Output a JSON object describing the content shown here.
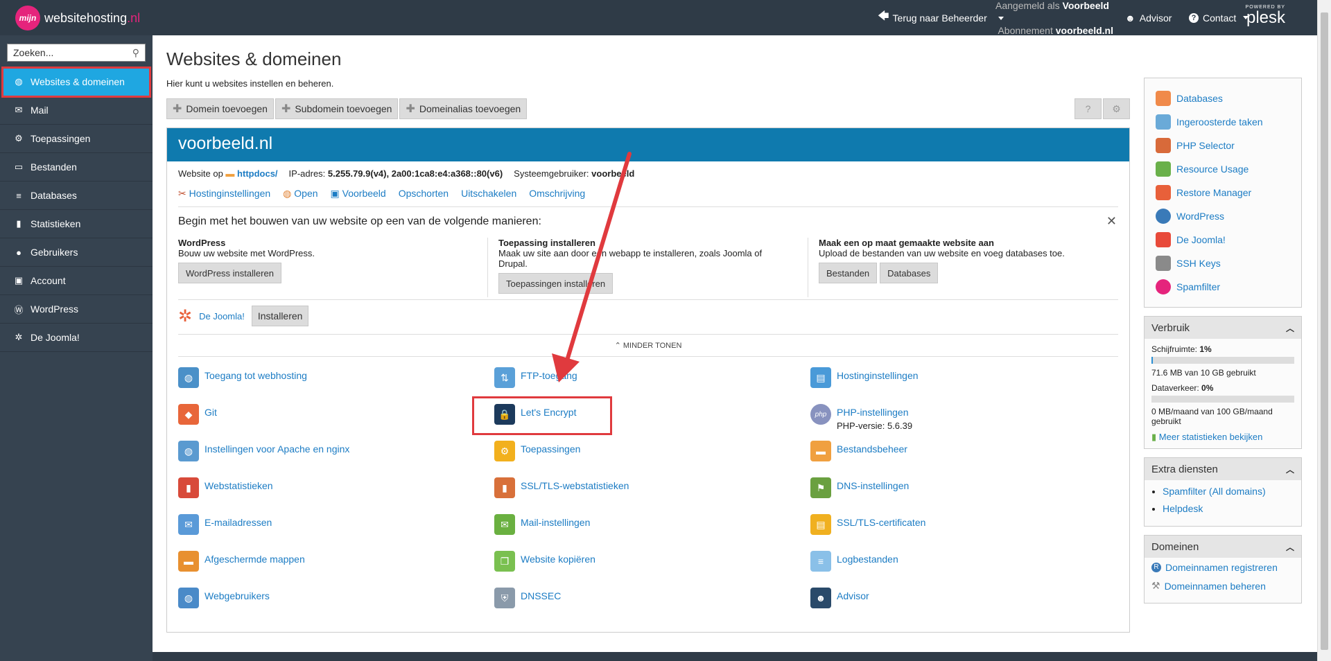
{
  "topbar": {
    "logo_prefix": "mijn",
    "logo_name": "websitehosting",
    "logo_tld": ".nl",
    "back_label": "Terug naar Beheerder",
    "logged_in_label": "Aangemeld als",
    "logged_in_user": "Voorbeeld",
    "subscription_label": "Abonnement",
    "subscription_value": "voorbeeld.nl",
    "advisor_label": "Advisor",
    "contact_label": "Contact",
    "powered_by": "POWERED BY",
    "plesk": "plesk"
  },
  "sidebar": {
    "search_placeholder": "Zoeken...",
    "items": [
      {
        "label": "Websites & domeinen",
        "icon": "globe-icon"
      },
      {
        "label": "Mail",
        "icon": "mail-icon"
      },
      {
        "label": "Toepassingen",
        "icon": "gear-icon"
      },
      {
        "label": "Bestanden",
        "icon": "folder-icon"
      },
      {
        "label": "Databases",
        "icon": "database-icon"
      },
      {
        "label": "Statistieken",
        "icon": "chart-icon"
      },
      {
        "label": "Gebruikers",
        "icon": "user-icon"
      },
      {
        "label": "Account",
        "icon": "account-icon"
      },
      {
        "label": "WordPress",
        "icon": "wordpress-icon"
      },
      {
        "label": "De Joomla!",
        "icon": "joomla-icon"
      }
    ]
  },
  "main": {
    "title": "Websites & domeinen",
    "subtitle": "Hier kunt u websites instellen en beheren.",
    "toolbar": [
      "Domein toevoegen",
      "Subdomein toevoegen",
      "Domeinalias toevoegen"
    ],
    "help_label": "?",
    "settings_label": "⚙",
    "domain": "voorbeeld.nl",
    "info": {
      "website_label": "Website op",
      "website_dir": "httpdocs/",
      "ip_label": "IP-adres:",
      "ip_value": "5.255.79.9(v4), 2a00:1ca8:e4:a368::80(v6)",
      "sysuser_label": "Systeemgebruiker:",
      "sysuser_value": "voorbeeld"
    },
    "links": [
      "Hostinginstellingen",
      "Open",
      "Voorbeeld",
      "Opschorten",
      "Uitschakelen",
      "Omschrijving"
    ],
    "build": {
      "title": "Begin met het bouwen van uw website op een van de volgende manieren:",
      "cols": [
        {
          "heading": "WordPress",
          "text": "Bouw uw website met WordPress.",
          "buttons": [
            "WordPress installeren"
          ]
        },
        {
          "heading": "Toepassing installeren",
          "text": "Maak uw site aan door een webapp te installeren, zoals Joomla of Drupal.",
          "buttons": [
            "Toepassingen installeren"
          ]
        },
        {
          "heading": "Maak een op maat gemaakte website aan",
          "text": "Upload de bestanden van uw website en voeg databases toe.",
          "buttons": [
            "Bestanden",
            "Databases"
          ]
        }
      ]
    },
    "joomla_label": "De Joomla!",
    "joomla_install": "Installeren",
    "less_label": "MINDER TONEN",
    "tools": [
      {
        "label": "Toegang tot webhosting",
        "color": "#4a90c8"
      },
      {
        "label": "FTP-toegang",
        "color": "#5aa0d8"
      },
      {
        "label": "Hostinginstellingen",
        "color": "#4a9ad8"
      },
      {
        "label": "Git",
        "color": "#e8663a"
      },
      {
        "label": "Let's Encrypt",
        "color": "#f2a81d"
      },
      {
        "label": "PHP-instellingen",
        "color": "#8892bf",
        "sub": "PHP-versie: 5.6.39"
      },
      {
        "label": "Instellingen voor Apache en nginx",
        "color": "#5a9ad0"
      },
      {
        "label": "Toepassingen",
        "color": "#f2b01d"
      },
      {
        "label": "Bestandsbeheer",
        "color": "#f0a040"
      },
      {
        "label": "Webstatistieken",
        "color": "#d84a3a"
      },
      {
        "label": "SSL/TLS-webstatistieken",
        "color": "#d8703a"
      },
      {
        "label": "DNS-instellingen",
        "color": "#6aa040"
      },
      {
        "label": "E-mailadressen",
        "color": "#5a9ad8"
      },
      {
        "label": "Mail-instellingen",
        "color": "#6ab040"
      },
      {
        "label": "SSL/TLS-certificaten",
        "color": "#f0b020"
      },
      {
        "label": "Afgeschermde mappen",
        "color": "#e89030"
      },
      {
        "label": "Website kopiëren",
        "color": "#7ac050"
      },
      {
        "label": "Logbestanden",
        "color": "#8ac0e8"
      },
      {
        "label": "Webgebruikers",
        "color": "#4a8ac8"
      },
      {
        "label": "DNSSEC",
        "color": "#8a9aaa"
      },
      {
        "label": "Advisor",
        "color": "#2a4a6a"
      }
    ]
  },
  "right": {
    "links": [
      {
        "label": "Databases",
        "color": "#f08a4a"
      },
      {
        "label": "Ingeroosterde taken",
        "color": "#6aaad8"
      },
      {
        "label": "PHP Selector",
        "color": "#d86a3a"
      },
      {
        "label": "Resource Usage",
        "color": "#6ab04a"
      },
      {
        "label": "Restore Manager",
        "color": "#e8603a"
      },
      {
        "label": "WordPress",
        "color": "#3a7ab8"
      },
      {
        "label": "De Joomla!",
        "color": "#e84a3a"
      },
      {
        "label": "SSH Keys",
        "color": "#8a8a8a"
      },
      {
        "label": "Spamfilter",
        "color": "#e5247c"
      }
    ],
    "usage_title": "Verbruik",
    "disk_label": "Schijfruimte:",
    "disk_pct": "1%",
    "disk_fill": 0.01,
    "disk_text": "71.6 MB van 10 GB gebruikt",
    "traffic_label": "Dataverkeer:",
    "traffic_pct": "0%",
    "traffic_fill": 0.0,
    "traffic_text": "0 MB/maand van 100 GB/maand gebruikt",
    "more_stats": "Meer statistieken bekijken",
    "extra_title": "Extra diensten",
    "extra_items": [
      "Spamfilter (All domains)",
      "Helpdesk"
    ],
    "domains_title": "Domeinen",
    "domains_items": [
      "Domeinnamen registreren",
      "Domeinnamen beheren"
    ]
  }
}
